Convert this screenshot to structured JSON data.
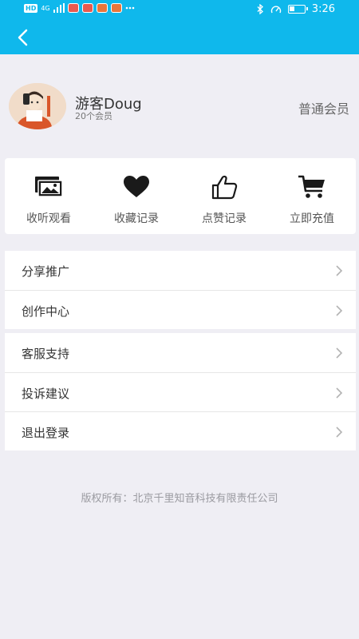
{
  "status_bar": {
    "network_badge": "HD",
    "signal_label": "4G",
    "time": "3:26",
    "more_icon": "more-dots-icon",
    "icons": [
      "bluetooth-icon",
      "speed-icon",
      "battery-icon"
    ]
  },
  "nav": {
    "back_icon": "back-arrow-icon"
  },
  "profile": {
    "name": "游客Doug",
    "subtitle": "20个会员",
    "level": "普通会员"
  },
  "quick_actions": [
    {
      "label": "收听观看",
      "icon": "photo-stack-icon"
    },
    {
      "label": "收藏记录",
      "icon": "heart-icon"
    },
    {
      "label": "点赞记录",
      "icon": "thumbs-up-icon"
    },
    {
      "label": "立即充值",
      "icon": "cart-icon"
    }
  ],
  "menu_group_1": [
    {
      "label": "分享推广"
    },
    {
      "label": "创作中心"
    }
  ],
  "menu_group_2": [
    {
      "label": "客服支持"
    },
    {
      "label": "投诉建议"
    },
    {
      "label": "退出登录"
    }
  ],
  "footer": {
    "copyright": "版权所有：北京千里知音科技有限责任公司"
  },
  "colors": {
    "accent": "#0fb8ec",
    "background": "#efeef4"
  }
}
